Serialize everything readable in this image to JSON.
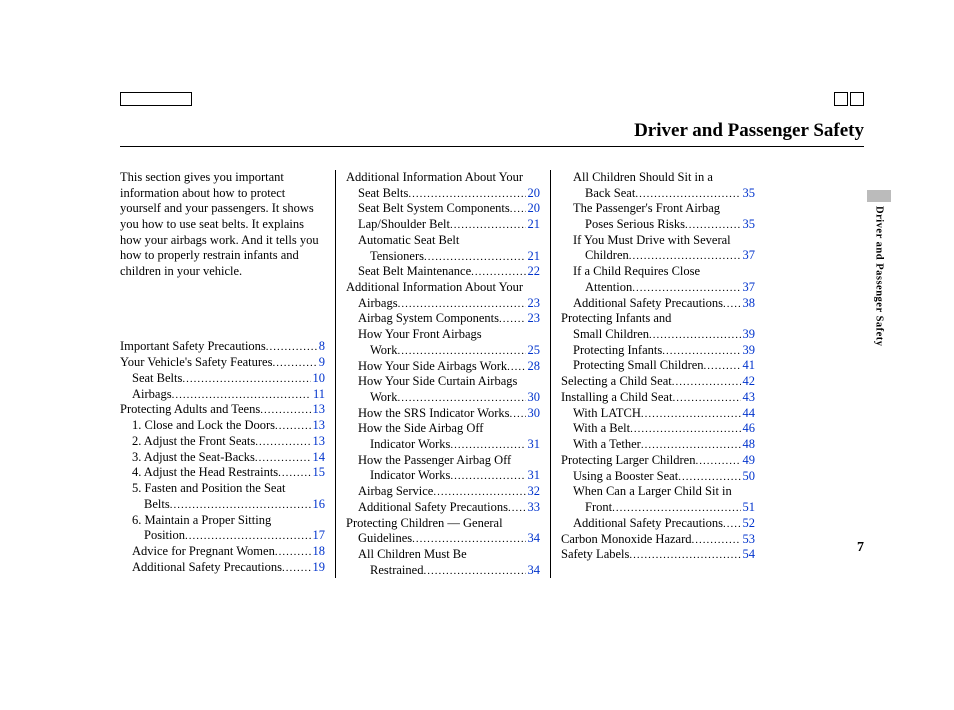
{
  "title": "Driver and Passenger Safety",
  "side_label": "Driver and Passenger Safety",
  "page_number": "7",
  "intro": "This section gives you important information about how to protect yourself and your passengers. It shows you how to use seat belts. It explains how your airbags work. And it tells you how to properly restrain infants and children in your vehicle.",
  "col1": [
    {
      "label": "Important Safety Precautions",
      "page": "8",
      "indent": 0
    },
    {
      "label": "Your Vehicle's Safety Features",
      "page": "9",
      "indent": 0
    },
    {
      "label": "Seat Belts",
      "page": "10",
      "indent": 1
    },
    {
      "label": "Airbags",
      "page": "11",
      "indent": 1
    },
    {
      "label": "Protecting Adults and Teens",
      "page": "13",
      "indent": 0
    },
    {
      "label": "1. Close and Lock the Doors",
      "page": "13",
      "indent": 1
    },
    {
      "label": "2. Adjust the Front Seats",
      "page": "13",
      "indent": 1
    },
    {
      "label": "3. Adjust the Seat-Backs",
      "page": "14",
      "indent": 1
    },
    {
      "label": "4. Adjust the Head Restraints",
      "page": "15",
      "indent": 1
    },
    {
      "label": "5. Fasten and Position the Seat",
      "indent": 1
    },
    {
      "label": "Belts",
      "page": "16",
      "indent": 2
    },
    {
      "label": "6. Maintain a Proper Sitting",
      "indent": 1
    },
    {
      "label": "Position",
      "page": "17",
      "indent": 2
    },
    {
      "label": "Advice for Pregnant Women",
      "page": "18",
      "indent": 1
    },
    {
      "label": "Additional Safety Precautions",
      "page": "19",
      "indent": 1
    }
  ],
  "col2": [
    {
      "label": "Additional Information About Your",
      "indent": 0
    },
    {
      "label": "Seat Belts",
      "page": "20",
      "indent": 1
    },
    {
      "label": "Seat Belt System Components",
      "page": "20",
      "indent": 1
    },
    {
      "label": "Lap/Shoulder Belt",
      "page": "21",
      "indent": 1
    },
    {
      "label": "Automatic Seat Belt",
      "indent": 1
    },
    {
      "label": "Tensioners",
      "page": "21",
      "indent": 2
    },
    {
      "label": "Seat Belt Maintenance",
      "page": "22",
      "indent": 1
    },
    {
      "label": "Additional Information About Your",
      "indent": 0
    },
    {
      "label": "Airbags",
      "page": "23",
      "indent": 1
    },
    {
      "label": "Airbag System Components",
      "page": "23",
      "indent": 1
    },
    {
      "label": "How Your Front Airbags",
      "indent": 1
    },
    {
      "label": "Work",
      "page": "25",
      "indent": 2
    },
    {
      "label": "How Your Side Airbags Work",
      "page": "28",
      "indent": 1
    },
    {
      "label": "How Your Side Curtain Airbags",
      "indent": 1
    },
    {
      "label": "Work",
      "page": "30",
      "indent": 2
    },
    {
      "label": "How the SRS Indicator Works",
      "page": "30",
      "indent": 1
    },
    {
      "label": "How the Side Airbag Off",
      "indent": 1
    },
    {
      "label": "Indicator Works",
      "page": "31",
      "indent": 2
    },
    {
      "label": "How the Passenger Airbag Off",
      "indent": 1
    },
    {
      "label": "Indicator Works",
      "page": "31",
      "indent": 2
    },
    {
      "label": "Airbag Service",
      "page": "32",
      "indent": 1
    },
    {
      "label": "Additional Safety Precautions",
      "page": "33",
      "indent": 1
    },
    {
      "label": "Protecting Children — General",
      "indent": 0
    },
    {
      "label": "Guidelines",
      "page": "34",
      "indent": 1
    },
    {
      "label": "All Children Must Be",
      "indent": 1
    },
    {
      "label": "Restrained",
      "page": "34",
      "indent": 2
    }
  ],
  "col3": [
    {
      "label": "All Children Should Sit in a",
      "indent": 1
    },
    {
      "label": "Back Seat",
      "page": "35",
      "indent": 2
    },
    {
      "label": "The Passenger's Front Airbag",
      "indent": 1
    },
    {
      "label": "Poses Serious Risks",
      "page": "35",
      "indent": 2
    },
    {
      "label": "If You Must Drive with Several",
      "indent": 1
    },
    {
      "label": "Children",
      "page": "37",
      "indent": 2
    },
    {
      "label": "If a Child Requires Close",
      "indent": 1
    },
    {
      "label": "Attention",
      "page": "37",
      "indent": 2
    },
    {
      "label": "Additional Safety Precautions",
      "page": "38",
      "indent": 1
    },
    {
      "label": "Protecting Infants and",
      "indent": 0
    },
    {
      "label": "Small Children",
      "page": "39",
      "indent": 1
    },
    {
      "label": "Protecting Infants",
      "page": "39",
      "indent": 1
    },
    {
      "label": "Protecting Small Children",
      "page": "41",
      "indent": 1
    },
    {
      "label": "Selecting a Child Seat",
      "page": "42",
      "indent": 0
    },
    {
      "label": "Installing a Child Seat",
      "page": "43",
      "indent": 0
    },
    {
      "label": "With LATCH",
      "page": "44",
      "indent": 1
    },
    {
      "label": "With a Belt",
      "page": "46",
      "indent": 1
    },
    {
      "label": "With a Tether",
      "page": "48",
      "indent": 1
    },
    {
      "label": "Protecting Larger Children",
      "page": "49",
      "indent": 0
    },
    {
      "label": "Using a Booster Seat",
      "page": "50",
      "indent": 1
    },
    {
      "label": "When Can a Larger Child Sit in",
      "indent": 1
    },
    {
      "label": "Front",
      "page": "51",
      "indent": 2
    },
    {
      "label": "Additional Safety Precautions",
      "page": "52",
      "indent": 1
    },
    {
      "label": "Carbon Monoxide Hazard",
      "page": "53",
      "indent": 0
    },
    {
      "label": "Safety Labels",
      "page": "54",
      "indent": 0
    }
  ]
}
